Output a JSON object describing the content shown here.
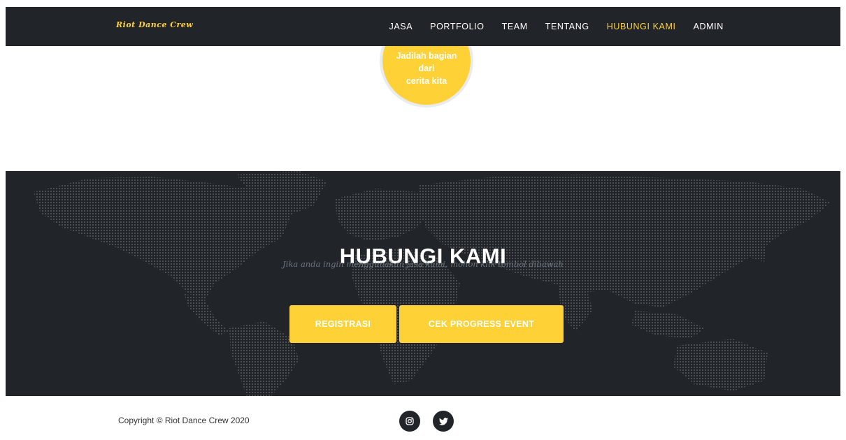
{
  "navbar": {
    "brand": "Riot Dance Crew",
    "links": [
      {
        "label": "JASA",
        "active": false
      },
      {
        "label": "PORTFOLIO",
        "active": false
      },
      {
        "label": "TEAM",
        "active": false
      },
      {
        "label": "TENTANG",
        "active": false
      },
      {
        "label": "HUBUNGI KAMI",
        "active": true
      },
      {
        "label": "ADMIN",
        "active": false
      }
    ]
  },
  "timeline_circle": {
    "lines": [
      "Jadilah bagian",
      "dari",
      "cerita kita"
    ]
  },
  "contact": {
    "title": "HUBUNGI KAMI",
    "subtitle": "Jika anda ingin menggunakan jasa kami, mohon klik tombol dibawah",
    "register_button": "REGISTRASI",
    "progress_button": "CEK PROGRESS EVENT"
  },
  "footer": {
    "copyright": "Copyright © Riot Dance Crew 2020",
    "social": [
      {
        "icon": "instagram-icon"
      },
      {
        "icon": "twitter-icon"
      }
    ]
  },
  "colors": {
    "dark": "#212529",
    "accent": "#fed136",
    "white": "#ffffff",
    "muted": "#6c757d"
  }
}
